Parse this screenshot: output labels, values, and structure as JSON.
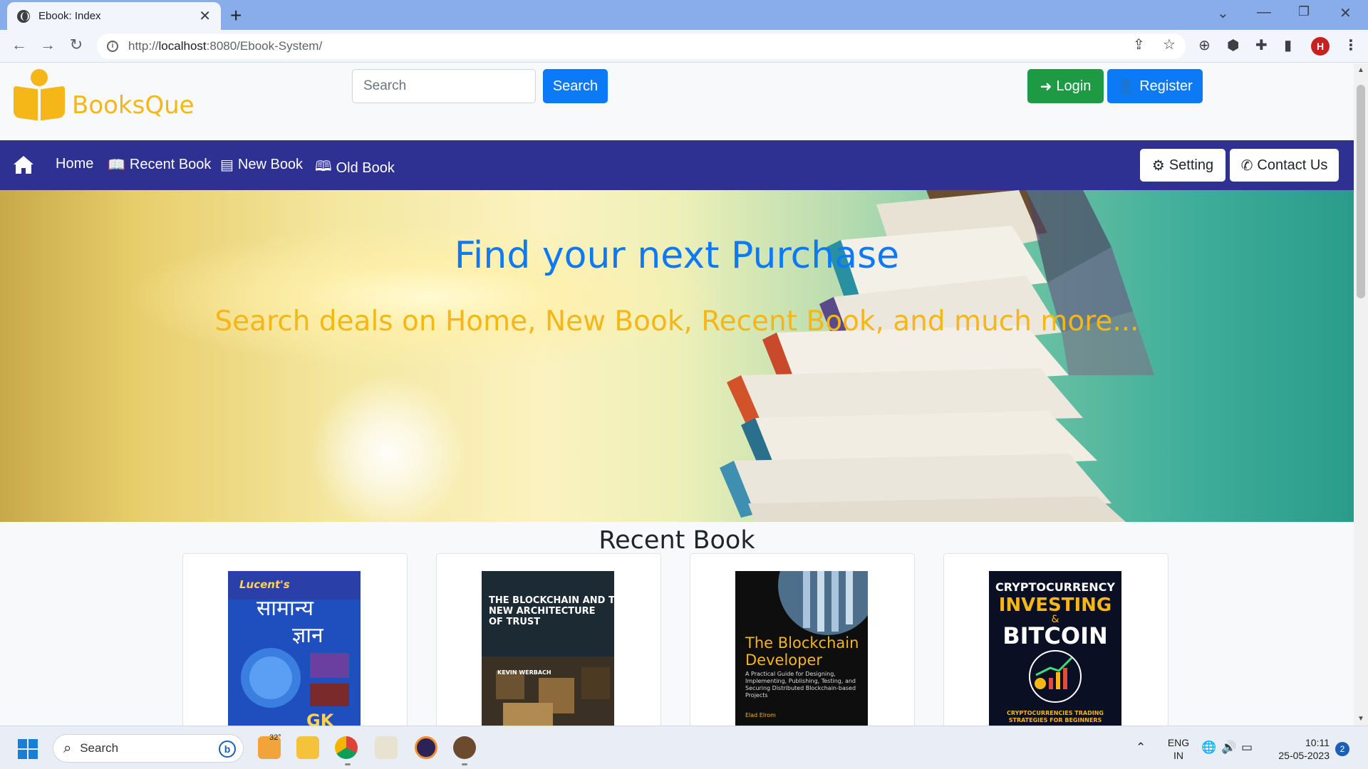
{
  "browser": {
    "tab_title": "Ebook: Index",
    "url_scheme": "http://",
    "url_host": "localhost",
    "url_rest": ":8080/Ebook-System/",
    "profile_initial": "H"
  },
  "header": {
    "brand": "BooksQue",
    "search_placeholder": "Search",
    "search_button": "Search",
    "login_button": "Login",
    "register_button": "Register"
  },
  "nav": {
    "items": [
      {
        "label": "Home",
        "icon": "home-icon"
      },
      {
        "label": "Recent Book",
        "icon": "book-open-icon"
      },
      {
        "label": "New Book",
        "icon": "book-icon"
      },
      {
        "label": "Old Book",
        "icon": "book-reader-icon"
      }
    ],
    "setting_button": "Setting",
    "contact_button": "Contact Us"
  },
  "hero": {
    "title": "Find your next Purchase",
    "subtitle": "Search deals on Home, New Book, Recent Book, and much more..."
  },
  "recent": {
    "title": "Recent Book",
    "books": [
      {
        "cover_lines": [
          "Lucent's",
          "सामान्य",
          "ज्ञान",
          "GK"
        ]
      },
      {
        "cover_lines": [
          "THE BLOCKCHAIN AND THE",
          "NEW ARCHITECTURE",
          "OF TRUST",
          "KEVIN WERBACH"
        ]
      },
      {
        "cover_lines": [
          "The Blockchain",
          "Developer",
          "A Practical Guide for Designing, Implementing, Publishing, Testing, and Securing Distributed Blockchain-based Projects",
          "Elad Elrom"
        ]
      },
      {
        "cover_lines": [
          "CRYPTOCURRENCY",
          "INVESTING",
          "&",
          "BITCOIN",
          "CRYPTOCURRENCIES TRADING STRATEGIES FOR BEGINNERS"
        ]
      }
    ]
  },
  "taskbar": {
    "search_label": "Search",
    "weather": "32°",
    "lang_top": "ENG",
    "lang_bottom": "IN",
    "time": "10:11",
    "date": "25-05-2023",
    "notifications": "2"
  },
  "colors": {
    "navbar": "#2e3192",
    "brand": "#f5b617",
    "primary": "#0d7af5",
    "success": "#1e9a45"
  }
}
